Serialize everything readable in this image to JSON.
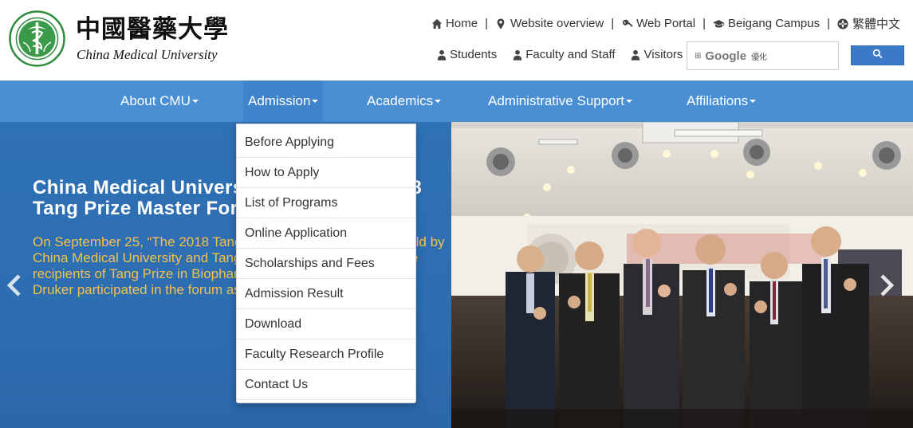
{
  "header": {
    "logo_chinese": "中國醫藥大學",
    "logo_english": "China Medical University",
    "top_links": [
      {
        "label": "Home",
        "icon": "home-icon"
      },
      {
        "label": "Website overview",
        "icon": "map-marker-icon"
      },
      {
        "label": "Web Portal",
        "icon": "key-icon"
      },
      {
        "label": "Beigang Campus",
        "icon": "graduation-cap-icon"
      },
      {
        "label": "繁體中文",
        "icon": "globe-icon"
      }
    ],
    "separator": "|",
    "audience_links": [
      {
        "label": "Students",
        "icon": "user-icon"
      },
      {
        "label": "Faculty and Staff",
        "icon": "user-icon"
      },
      {
        "label": "Visitors",
        "icon": "user-icon"
      }
    ],
    "search": {
      "google_label": "Google",
      "google_sub": "優化",
      "button_icon": "search-icon"
    }
  },
  "nav": {
    "items": [
      {
        "label": "About CMU"
      },
      {
        "label": "Admission"
      },
      {
        "label": "Academics"
      },
      {
        "label": "Administrative Support"
      },
      {
        "label": "Affiliations"
      }
    ]
  },
  "dropdown": {
    "items": [
      {
        "label": "Before Applying"
      },
      {
        "label": "How to Apply"
      },
      {
        "label": "List of Programs"
      },
      {
        "label": "Online Application"
      },
      {
        "label": "Scholarships and Fees"
      },
      {
        "label": "Admission Result"
      },
      {
        "label": "Download"
      },
      {
        "label": "Faculty Research Profile"
      },
      {
        "label": "Contact Us"
      }
    ]
  },
  "slide": {
    "title": "China Medical University hosted the 2018 Tang Prize Master Forum",
    "description": "On September 25, “The 2018 Tang Prize Master Forum” was held by China Medical University and Tang Prize Foundation. One of the recipients of Tang Prize in Biopharmaceutical Science-Dr. Brian Druker participated in the forum as the keynote speaker..."
  },
  "colors": {
    "nav_bg": "#4a8fd4",
    "slide_bg": "#2d6fb3",
    "slide_desc": "#f2c24e",
    "search_button": "#3a7ac9"
  }
}
